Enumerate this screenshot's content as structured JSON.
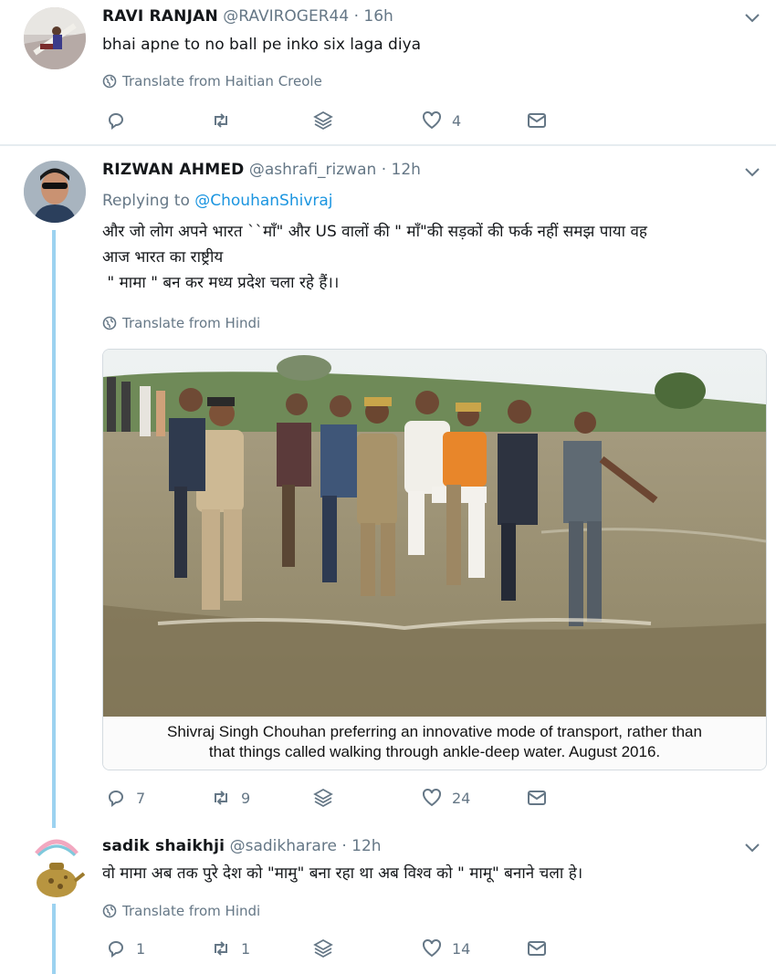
{
  "tweets": [
    {
      "name": "RAVI RANJAN",
      "handle": "@RAVIROGER44",
      "dot": "·",
      "time": "16h",
      "text": "bhai apne to no ball pe inko six  laga diya",
      "translate": "Translate from Haitian Creole",
      "counts": {
        "reply": "",
        "retweet": "",
        "like": "4"
      }
    },
    {
      "name": "RIZWAN AHMED",
      "handle": "@ashrafi_rizwan",
      "dot": "·",
      "time": "12h",
      "replying_prefix": "Replying to",
      "replying_to": "@ChouhanShivraj",
      "text_line1": "और जो लोग अपने भारत ``माँ\" और US वालों की \" माँ\"की  सड़कों की फर्क नहीं समझ पाया वह",
      "text_line2": "आज भारत का राष्ट्रीय",
      "text_line3": " \" मामा \" बन कर मध्य प्रदेश चला रहे हैं।।",
      "translate": "Translate from Hindi",
      "media_caption_line1": "Shivraj Singh Chouhan preferring an innovative mode of transport, rather than",
      "media_caption_line2": "that things called walking through ankle-deep water. August 2016.",
      "counts": {
        "reply": "7",
        "retweet": "9",
        "like": "24"
      }
    },
    {
      "name": "sadik shaikhji",
      "handle": "@sadikharare",
      "dot": "·",
      "time": "12h",
      "text": "वो मामा अब तक पुरे देश को \"मामु\" बना रहा था अब विश्व को \" मामू\" बनाने चला हे।",
      "translate": "Translate from Hindi",
      "counts": {
        "reply": "1",
        "retweet": "1",
        "like": "14"
      }
    }
  ],
  "icons": {
    "reply": "reply-icon",
    "retweet": "retweet-icon",
    "stack": "stack-icon",
    "like": "heart-icon",
    "dm": "message-icon",
    "globe": "globe-icon",
    "chevron": "chevron-down-icon"
  },
  "colors": {
    "link": "#1b95e0",
    "muted": "#657786",
    "thread": "#9cd2f0"
  }
}
